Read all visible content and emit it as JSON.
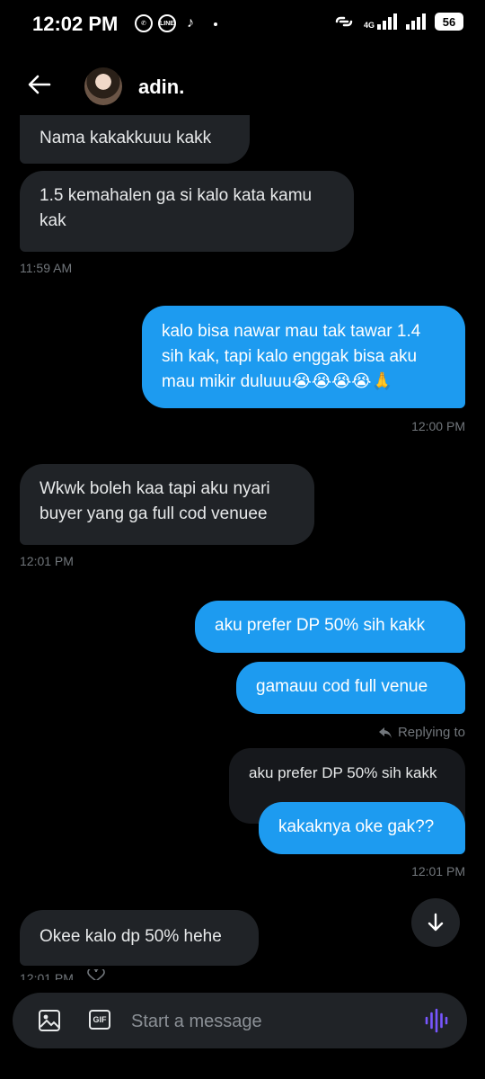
{
  "status_bar": {
    "time": "12:02 PM",
    "network": "4G",
    "battery": "56",
    "app_icons": [
      "whatsapp-icon",
      "line-icon",
      "tiktok-icon"
    ]
  },
  "header": {
    "contact_name": "adin."
  },
  "messages": [
    {
      "side": "in",
      "text": "Nama kakakkuuu kakk"
    },
    {
      "side": "in",
      "text": "1.5 kemahalen ga si kalo kata kamu kak"
    },
    {
      "side": "in",
      "timestamp": "11:59 AM"
    },
    {
      "side": "out",
      "text": "kalo bisa nawar mau tak tawar 1.4 sih kak, tapi kalo enggak bisa aku mau mikir duluuu😭😭😭😭🙏"
    },
    {
      "side": "out",
      "timestamp": "12:00 PM"
    },
    {
      "side": "in",
      "text": "Wkwk boleh kaa tapi aku nyari buyer yang ga full cod venuee"
    },
    {
      "side": "in",
      "timestamp": "12:01 PM"
    },
    {
      "side": "out",
      "text": "aku prefer DP 50% sih kakk"
    },
    {
      "side": "out",
      "text": "gamauu cod full venue"
    },
    {
      "side": "out",
      "replying_label": "Replying to",
      "quoted_text": "aku prefer DP 50% sih kakk"
    },
    {
      "side": "out",
      "text": "kakaknya oke gak??"
    },
    {
      "side": "out",
      "timestamp": "12:01 PM"
    },
    {
      "side": "in",
      "text": "Okee kalo dp 50% hehe"
    },
    {
      "side": "in",
      "timestamp": "12:01 PM"
    }
  ],
  "composer": {
    "placeholder": "Start a message",
    "gif_label": "GIF"
  },
  "colors": {
    "background": "#000000",
    "incoming_bubble": "#202327",
    "outgoing_bubble": "#1d9bf0",
    "voice_accent": "#7856ff"
  }
}
